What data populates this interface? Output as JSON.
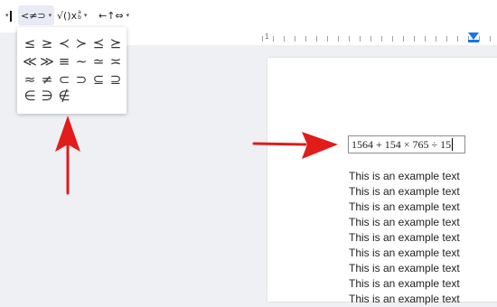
{
  "toolbar": {
    "relations_label": "<≠⊃",
    "math_ops_label": "√()x",
    "math_ops_sup": "a",
    "math_ops_sub": "b",
    "arrows_label": "←↑⇔",
    "caret": "▾"
  },
  "ruler": {
    "number": "1"
  },
  "symbols": {
    "row1": [
      "≤",
      "≥",
      "≺",
      "≻",
      "⪯",
      "⪰"
    ],
    "row2": [
      "≪",
      "≫",
      "≡",
      "∼",
      "≃",
      "≍"
    ],
    "row3": [
      "≈",
      "≠",
      "⊂",
      "⊃",
      "⊆",
      "⊇"
    ],
    "row4": [
      "∈",
      "∋",
      "∉"
    ]
  },
  "document": {
    "equation": "1564 + 154  ×  765  ÷ 15",
    "lines": [
      "This is an example text",
      "This is an example text",
      "This is an example text",
      "This is an example text",
      "This is an example text",
      "This is an example text",
      "This is an example text",
      "This is an example text",
      "This is an example text"
    ]
  },
  "colors": {
    "arrow": "#e21b1b",
    "ruler_marker": "#1a73e8"
  }
}
